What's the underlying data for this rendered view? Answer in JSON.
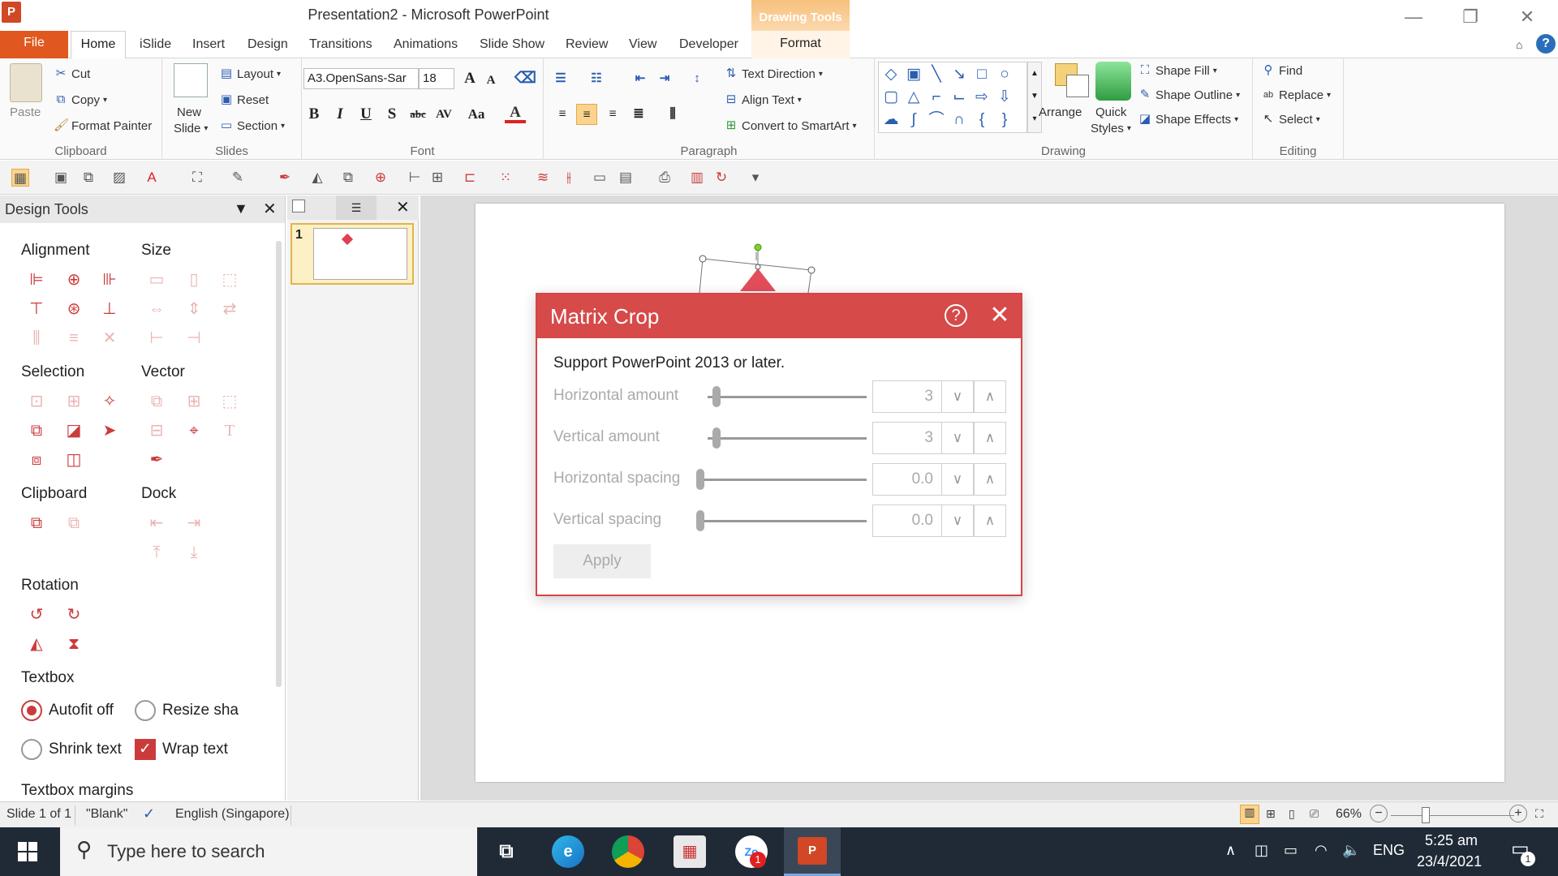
{
  "window": {
    "app_icon": "P",
    "title": "Presentation2 - Microsoft PowerPoint",
    "contextual_tab_group": "Drawing Tools",
    "minimize_glyph": "—",
    "restore_glyph": "❐",
    "close_glyph": "✕"
  },
  "tabs": [
    "File",
    "Home",
    "iSlide",
    "Insert",
    "Design",
    "Transitions",
    "Animations",
    "Slide Show",
    "Review",
    "View",
    "Developer",
    "Format"
  ],
  "ribbon": {
    "clipboard": {
      "label": "Clipboard",
      "paste": "Paste",
      "cut": "Cut",
      "copy": "Copy",
      "format_painter": "Format Painter"
    },
    "slides": {
      "label": "Slides",
      "new_slide_line1": "New",
      "new_slide_line2": "Slide",
      "layout": "Layout",
      "reset": "Reset",
      "section": "Section"
    },
    "font": {
      "label": "Font",
      "font_name": "A3.OpenSans-Sar",
      "font_size": "18"
    },
    "paragraph": {
      "label": "Paragraph",
      "text_direction": "Text Direction",
      "align_text": "Align Text",
      "convert_smartart": "Convert to SmartArt"
    },
    "drawing": {
      "label": "Drawing",
      "arrange": "Arrange",
      "quick_styles_line1": "Quick",
      "quick_styles_line2": "Styles",
      "shape_fill": "Shape Fill",
      "shape_outline": "Shape Outline",
      "shape_effects": "Shape Effects"
    },
    "editing": {
      "label": "Editing",
      "find": "Find",
      "replace": "Replace",
      "select": "Select"
    }
  },
  "design_tools": {
    "title": "Design Tools",
    "sections": {
      "alignment": "Alignment",
      "size": "Size",
      "selection": "Selection",
      "vector": "Vector",
      "clipboard": "Clipboard",
      "dock": "Dock",
      "rotation": "Rotation",
      "textbox": "Textbox",
      "textbox_margins": "Textbox margins"
    },
    "textbox_options": {
      "autofit_off": "Autofit off",
      "resize_shape": "Resize sha",
      "shrink_text": "Shrink text",
      "wrap_text": "Wrap text"
    },
    "autofit_off_selected": true,
    "wrap_text_checked": true
  },
  "thumbnails": {
    "slide_number": "1"
  },
  "dialog": {
    "title": "Matrix Crop",
    "help_glyph": "?",
    "close_glyph": "✕",
    "support_text": "Support PowerPoint 2013 or later.",
    "rows": [
      {
        "label": "Horizontal amount",
        "value": "3"
      },
      {
        "label": "Vertical amount",
        "value": "3"
      },
      {
        "label": "Horizontal spacing",
        "value": "0.0"
      },
      {
        "label": "Vertical spacing",
        "value": "0.0"
      }
    ],
    "apply": "Apply",
    "accent_color": "#d64a4a"
  },
  "statusbar": {
    "slide_info": "Slide 1 of 1",
    "theme": "\"Blank\"",
    "language": "English (Singapore)",
    "zoom": "66%"
  },
  "taskbar": {
    "search_placeholder": "Type here to search",
    "language": "ENG",
    "time": "5:25 am",
    "date": "23/4/2021",
    "notification_count": "1"
  }
}
